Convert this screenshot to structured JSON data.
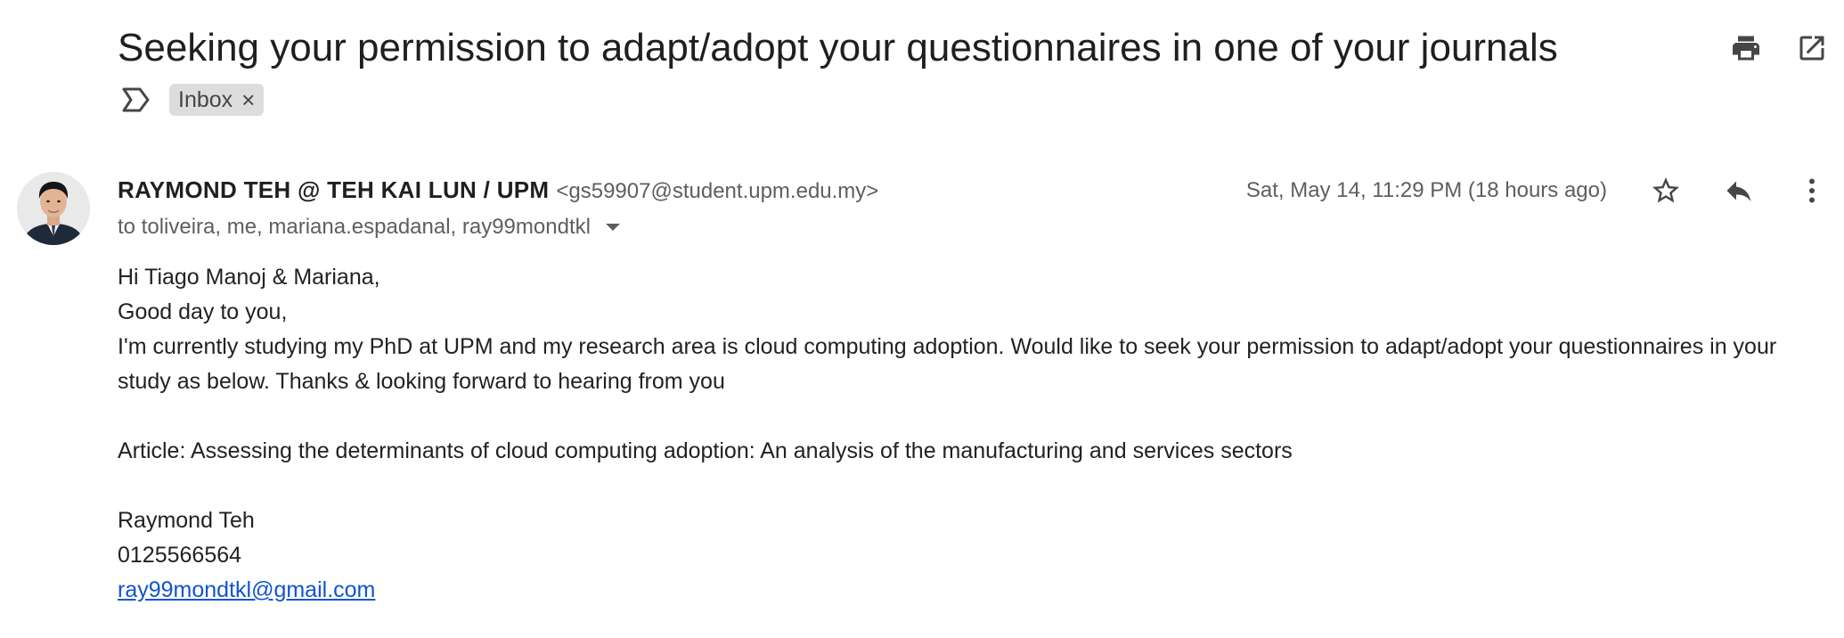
{
  "email": {
    "subject": "Seeking your permission to adapt/adopt your questionnaires in one of your journals",
    "label": "Inbox",
    "sender": {
      "name": "RAYMOND TEH @ TEH KAI LUN / UPM",
      "email": "<gs59907@student.upm.edu.my>"
    },
    "recipients": "to toliveira, me, mariana.espadanal, ray99mondtkl",
    "date": "Sat, May 14, 11:29 PM (18 hours ago)",
    "body": {
      "greeting": "Hi Tiago Manoj & Mariana,",
      "line2": "Good day to you,",
      "line3": "I'm currently studying my PhD at UPM and my research area is cloud computing adoption. Would like to seek your permission to adapt/adopt your questionnaires in your study as below. Thanks & looking forward to hearing from you",
      "article": "Article: Assessing the determinants of cloud computing adoption: An analysis of the manufacturing and services sectors",
      "signature_name": "Raymond Teh",
      "signature_phone": "0125566564",
      "signature_email": "ray99mondtkl@gmail.com"
    }
  },
  "icons": {
    "print": "print-icon",
    "open_new_window": "open-in-new-window-icon",
    "importance": "importance-marker-icon",
    "star": "star-icon",
    "reply": "reply-icon",
    "more": "more-vertical-icon"
  }
}
